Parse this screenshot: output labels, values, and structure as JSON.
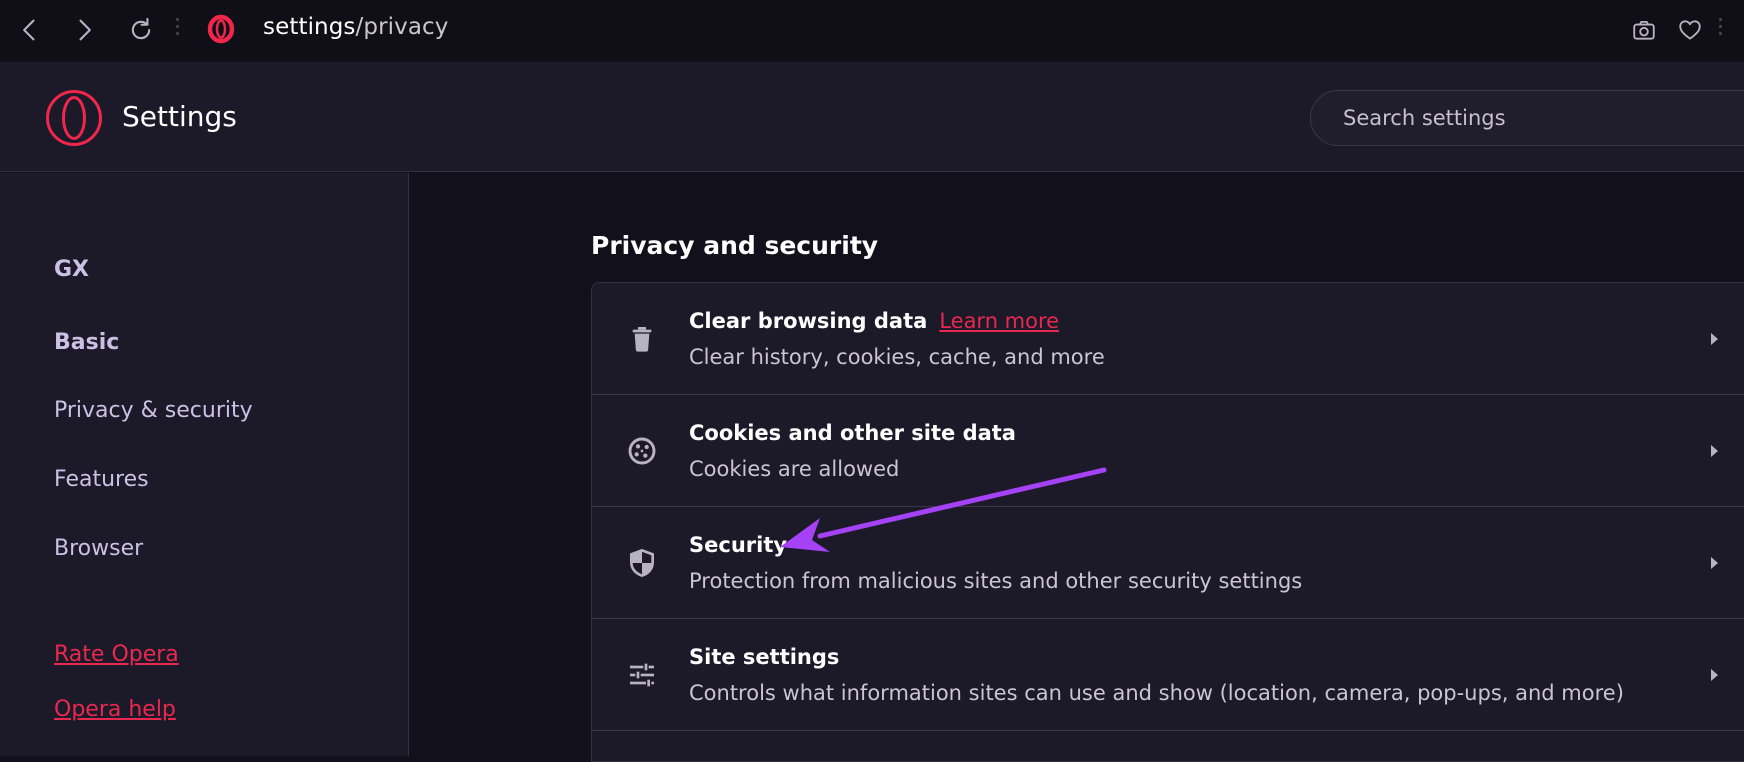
{
  "browser": {
    "url_host": "settings",
    "url_path": "/privacy"
  },
  "header": {
    "title": "Settings",
    "search_placeholder": "Search settings"
  },
  "sidebar": {
    "items": [
      {
        "label": "GX"
      },
      {
        "label": "Basic"
      },
      {
        "label": "Privacy & security"
      },
      {
        "label": "Features"
      },
      {
        "label": "Browser"
      }
    ],
    "links": [
      {
        "label": "Rate Opera"
      },
      {
        "label": "Opera help"
      }
    ]
  },
  "main": {
    "section_title": "Privacy and security",
    "rows": [
      {
        "icon": "trash-icon",
        "title": "Clear browsing data",
        "link": "Learn more",
        "subtitle": "Clear history, cookies, cache, and more"
      },
      {
        "icon": "cookie-icon",
        "title": "Cookies and other site data",
        "subtitle": "Cookies are allowed"
      },
      {
        "icon": "shield-icon",
        "title": "Security",
        "subtitle": "Protection from malicious sites and other security settings"
      },
      {
        "icon": "sliders-icon",
        "title": "Site settings",
        "subtitle": "Controls what information sites can use and show (location, camera, pop-ups, and more)"
      }
    ]
  },
  "colors": {
    "accent": "#e8284e",
    "annotation": "#a542f5",
    "background": "#12101a",
    "panel": "#1c1929"
  }
}
